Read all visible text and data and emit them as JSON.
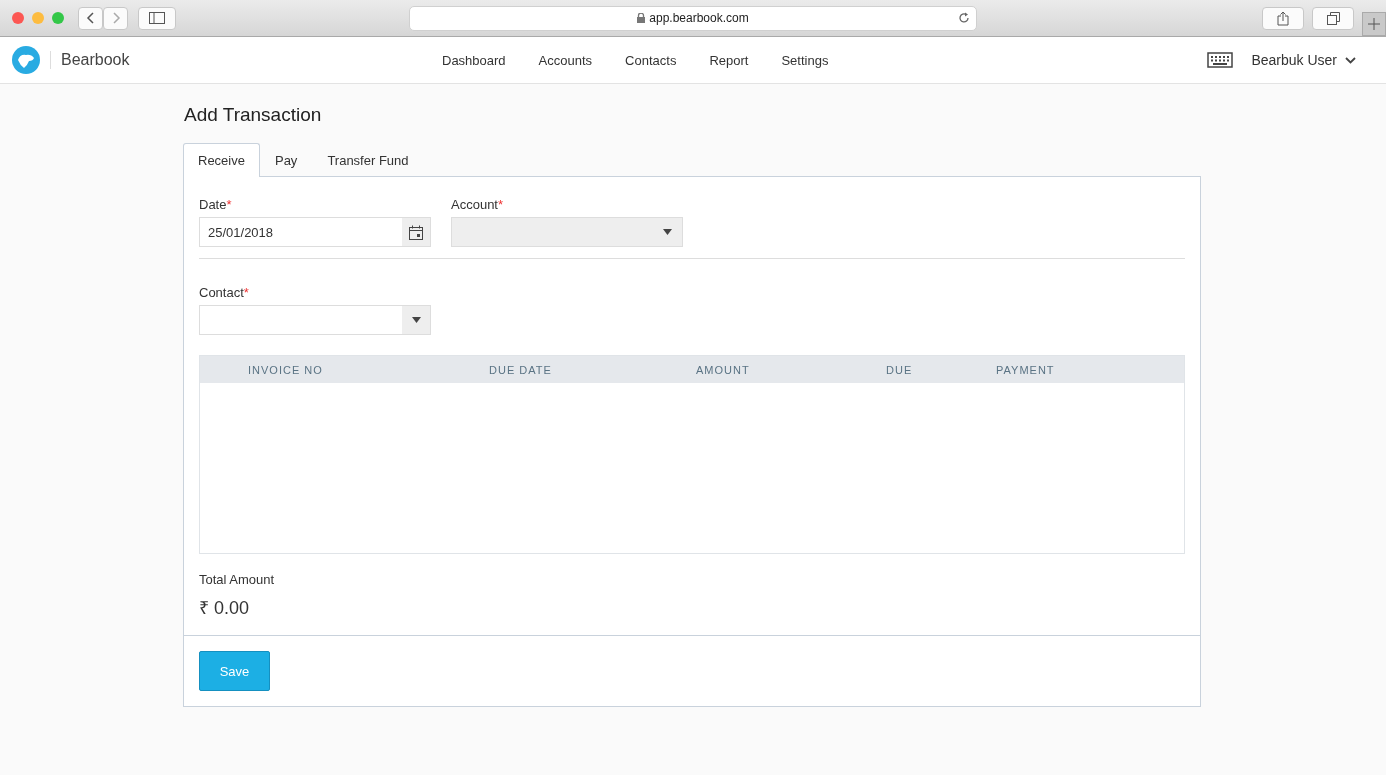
{
  "browser": {
    "url": "app.bearbook.com"
  },
  "app": {
    "name": "Bearbook",
    "nav": [
      {
        "label": "Dashboard",
        "selected": false
      },
      {
        "label": "Accounts",
        "selected": false
      },
      {
        "label": "Contacts",
        "selected": false
      },
      {
        "label": "Report",
        "selected": false
      },
      {
        "label": "Settings",
        "selected": false
      }
    ],
    "user": "Bearbuk User"
  },
  "page": {
    "title": "Add Transaction"
  },
  "tabs": [
    {
      "label": "Receive",
      "selected": true
    },
    {
      "label": "Pay",
      "selected": false
    },
    {
      "label": "Transfer Fund",
      "selected": false
    }
  ],
  "fields": {
    "date": {
      "label": "Date",
      "required_mark": "*",
      "value": "25/01/2018"
    },
    "account": {
      "label": "Account",
      "required_mark": "*",
      "disabled": true
    },
    "contact": {
      "label": "Contact",
      "required_mark": "*",
      "disabled": false
    }
  },
  "table": {
    "columns": [
      "INVOICE NO",
      "DUE DATE",
      "AMOUNT",
      "DUE",
      "PAYMENT"
    ]
  },
  "total": {
    "label": "Total Amount",
    "value": "₹ 0.00"
  },
  "buttons": [
    "Save"
  ]
}
